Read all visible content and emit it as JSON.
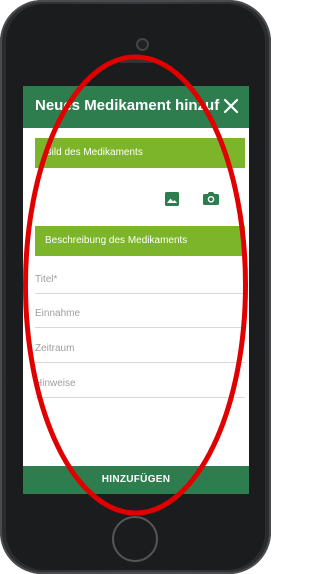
{
  "appbar": {
    "title": "Neues Medikament hinzuf...",
    "close_icon": "close-icon"
  },
  "image_section": {
    "header": "Bild des Medikaments",
    "gallery_icon": "image-icon",
    "camera_icon": "camera-icon"
  },
  "description_section": {
    "header": "Beschreibung des Medikaments",
    "fields": [
      {
        "placeholder": "Titel*",
        "value": ""
      },
      {
        "placeholder": "Einnahme",
        "value": ""
      },
      {
        "placeholder": "Zeitraum",
        "value": ""
      },
      {
        "placeholder": "Hinweise",
        "value": ""
      }
    ]
  },
  "submit_label": "HINZUFÜGEN",
  "colors": {
    "primary": "#2e7d4f",
    "section_green": "#7cb529",
    "annotation_red": "#e00000"
  }
}
